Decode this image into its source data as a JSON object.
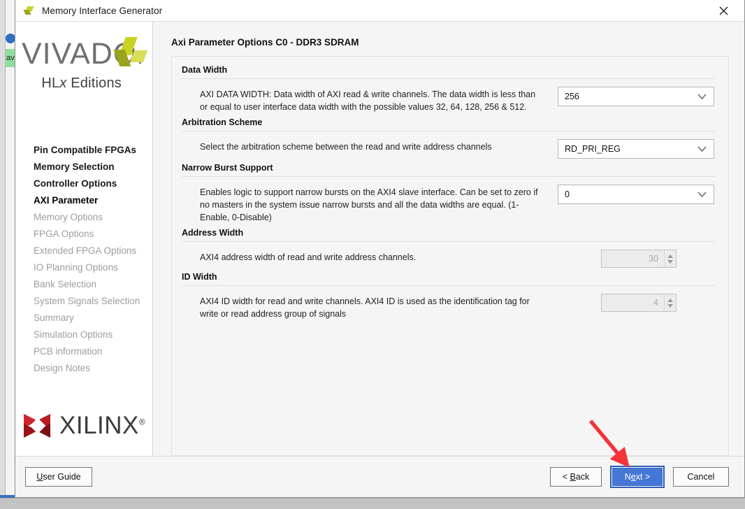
{
  "window": {
    "title": "Memory Interface Generator",
    "icon": "vivado-leaf-icon",
    "close_icon": "close-icon"
  },
  "sidebar": {
    "logo": {
      "word": "VIVADO",
      "dot": ".",
      "subtitle_prefix": "HL",
      "subtitle_italic": "x",
      "subtitle_suffix": " Editions",
      "mark_colors": [
        "#c9d321",
        "#9aa41a",
        "#d6de55"
      ]
    },
    "items": [
      {
        "label": "Pin Compatible FPGAs",
        "state": "enabled"
      },
      {
        "label": "Memory Selection",
        "state": "enabled"
      },
      {
        "label": "Controller Options",
        "state": "enabled"
      },
      {
        "label": "AXI Parameter",
        "state": "current"
      },
      {
        "label": "Memory Options",
        "state": "disabled"
      },
      {
        "label": "FPGA Options",
        "state": "disabled"
      },
      {
        "label": "Extended FPGA Options",
        "state": "disabled"
      },
      {
        "label": "IO Planning Options",
        "state": "disabled"
      },
      {
        "label": "Bank Selection",
        "state": "disabled"
      },
      {
        "label": "System Signals Selection",
        "state": "disabled"
      },
      {
        "label": "Summary",
        "state": "disabled"
      },
      {
        "label": "Simulation Options",
        "state": "disabled"
      },
      {
        "label": "PCB information",
        "state": "disabled"
      },
      {
        "label": "Design Notes",
        "state": "disabled"
      }
    ],
    "vendor_logo": {
      "word": "XILINX",
      "registered": "®",
      "mark_color": "#c0202a"
    }
  },
  "main": {
    "page_title": "Axi Parameter Options C0 - DDR3 SDRAM",
    "sections": [
      {
        "title": "Data Width",
        "description": "AXI DATA WIDTH: Data width of AXI read & write channels. The data width is less than or equal to user interface data width with the possible values 32, 64, 128, 256 & 512.",
        "control": "combo",
        "value": "256"
      },
      {
        "title": "Arbitration Scheme",
        "description": "Select the arbitration scheme between the read and write address channels",
        "control": "combo",
        "value": "RD_PRI_REG"
      },
      {
        "title": "Narrow Burst Support",
        "description": "Enables logic to support narrow bursts on the AXI4 slave interface. Can be set to zero if no masters in the system issue narrow bursts and all the data widths are equal. (1-Enable, 0-Disable)",
        "control": "combo",
        "value": "0"
      },
      {
        "title": "Address Width",
        "description": "AXI4 address width of read and write address channels.",
        "control": "spinner",
        "value": "30",
        "disabled": true
      },
      {
        "title": "ID Width",
        "description": "AXI4 ID width for read and write channels. AXI4 ID is used as the identification tag for write or read address group of signals",
        "control": "spinner",
        "value": "4",
        "disabled": true
      }
    ]
  },
  "footer": {
    "user_guide": "User Guide",
    "back": "< Back",
    "next": "Next >",
    "cancel": "Cancel"
  },
  "annotation": {
    "arrow_color": "#f5333a",
    "points_to": "next-button"
  }
}
